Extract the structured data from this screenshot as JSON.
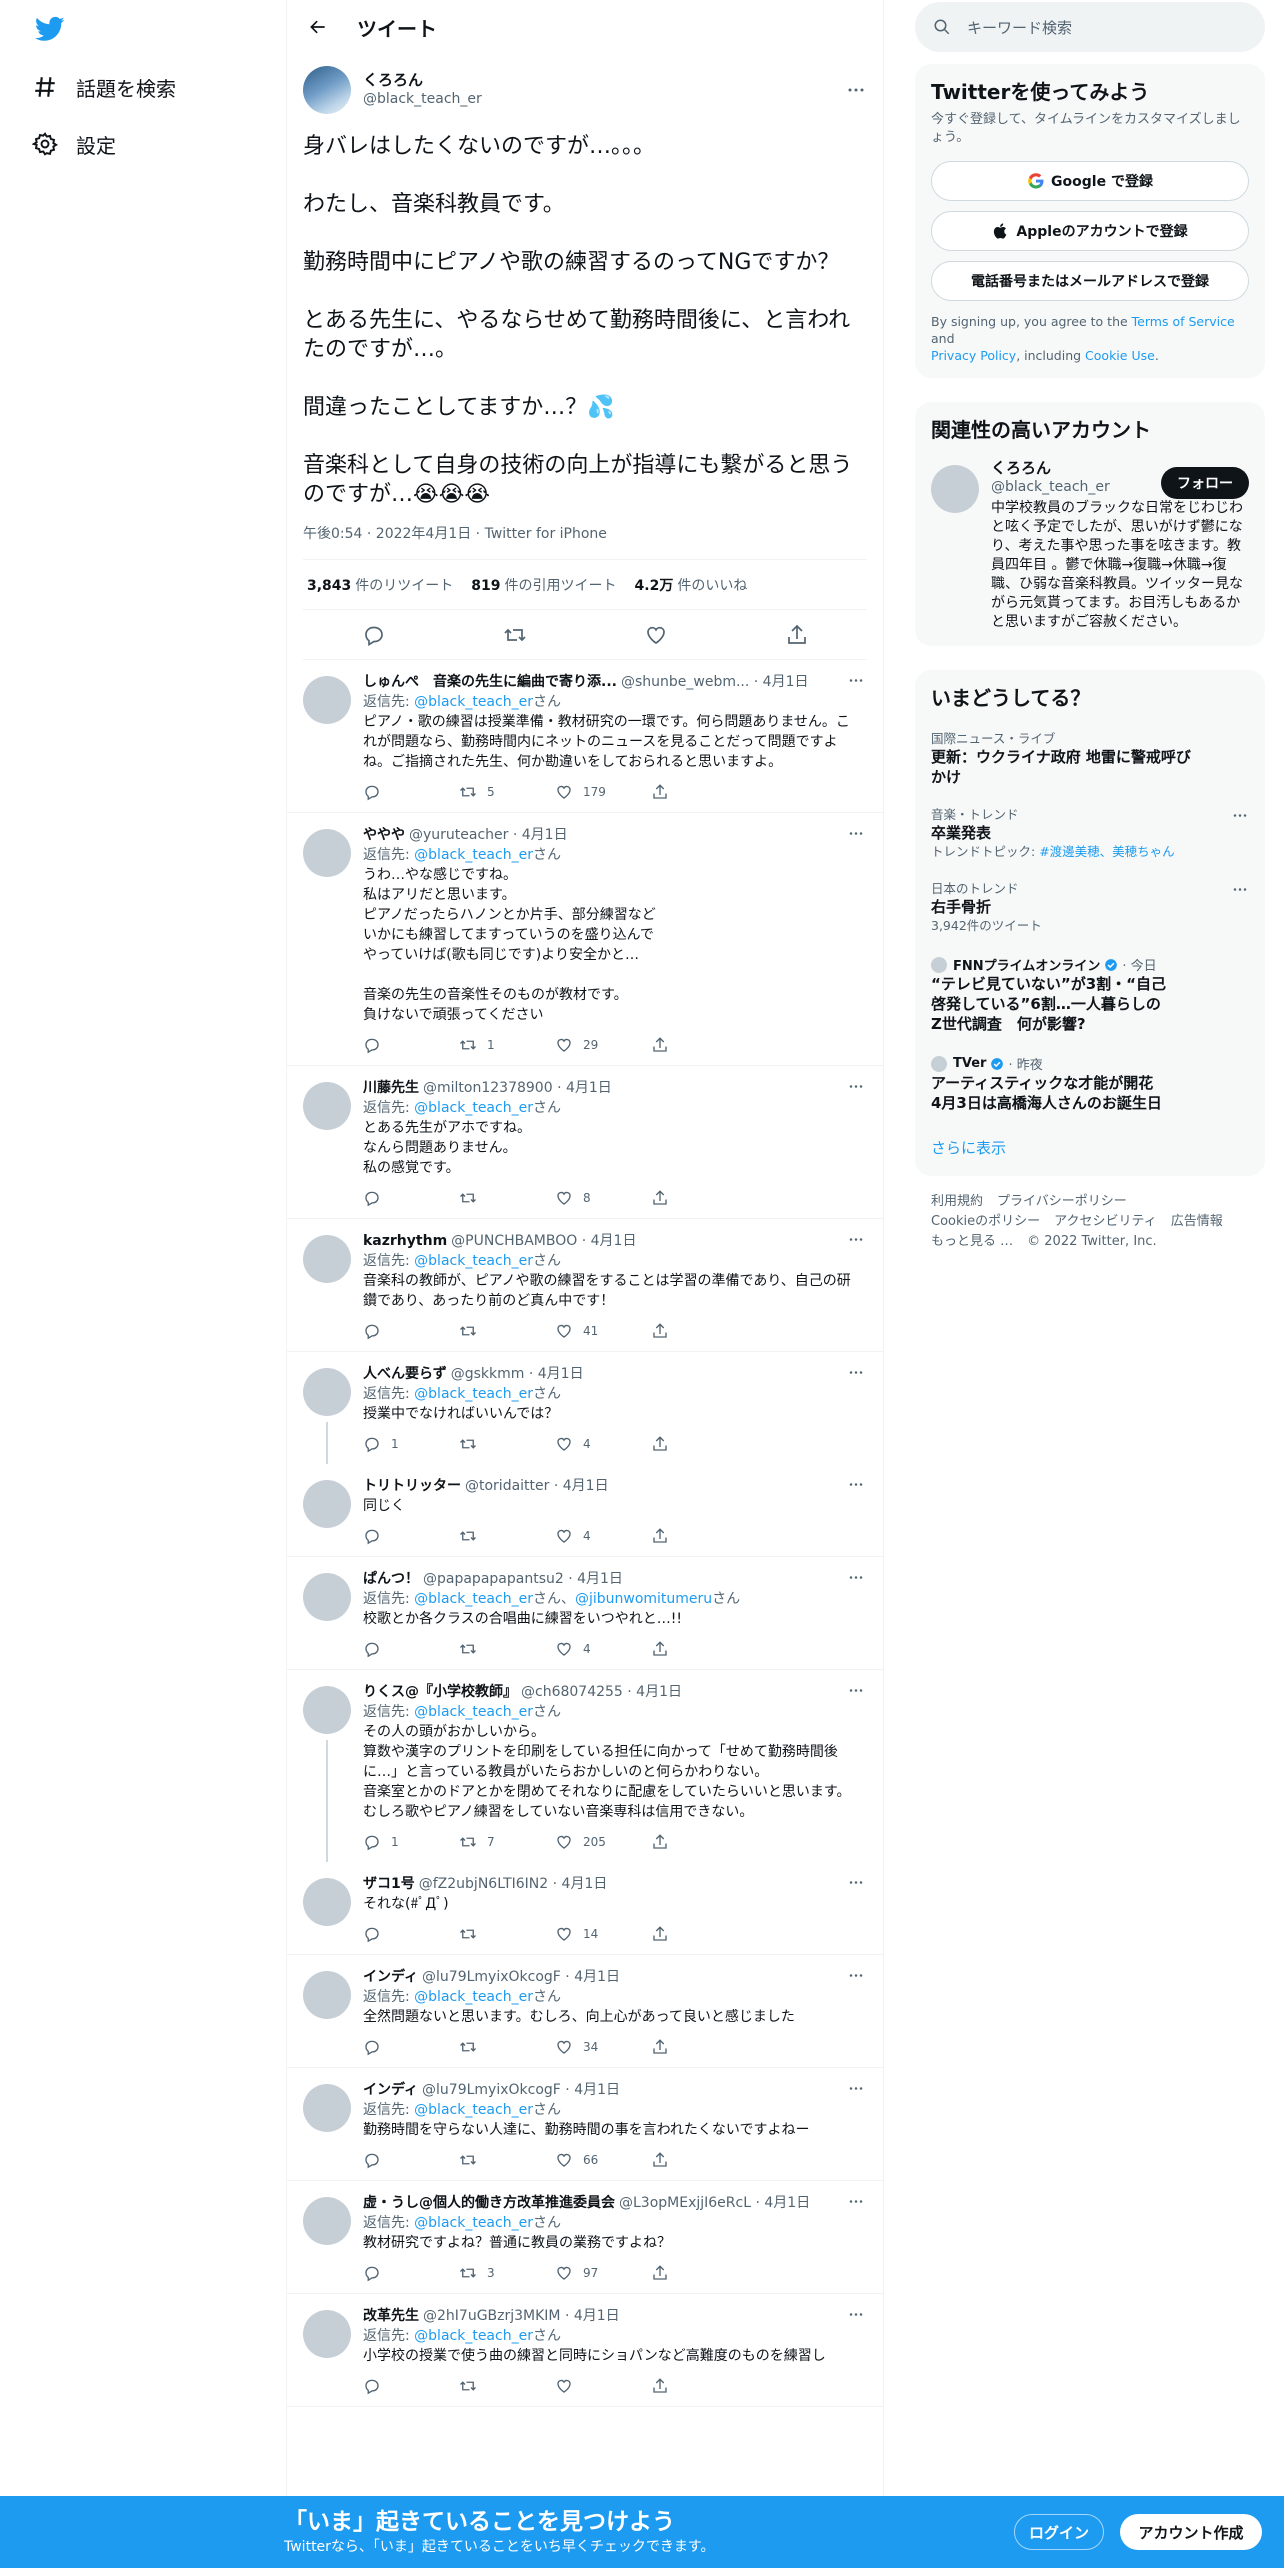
{
  "nav": {
    "explore_label": "話題を検索",
    "settings_label": "設定"
  },
  "header": {
    "title": "ツイート"
  },
  "tweet": {
    "name": "くろろん",
    "handle": "@black_teach_er",
    "paragraphs": [
      "身バレはしたくないのですが…。。。",
      "わたし、音楽科教員です。",
      "勤務時間中にピアノや歌の練習するのってNGですか？",
      "とある先生に、やるならせめて勤務時間後に、と言われたのですが…。",
      "間違ったことしてますか…？💦",
      "音楽科として自身の技術の向上が指導にも繋がると思うのですが…😭😭😭"
    ],
    "meta": "午後0:54 · 2022年4月1日 · Twitter for iPhone",
    "stats": [
      {
        "value": "3,843",
        "label": "件のリツイート"
      },
      {
        "value": "819",
        "label": "件の引用ツイート"
      },
      {
        "value": "4.2万",
        "label": "件のいいね"
      }
    ]
  },
  "replies": [
    {
      "name": "しゅんぺ　音楽の先生に編曲で寄り添...",
      "handle": "@shunbe_webm...",
      "date": "· 4月1日",
      "replyto": [
        "@black_teach_er"
      ],
      "text": "ピアノ・歌の練習は授業準備・教材研究の一環です。何ら問題ありません。これが問題なら、勤務時間内にネットのニュースを見ることだって問題ですよね。ご指摘された先生、何か勘違いをしておられると思いますよ。",
      "rt": "5",
      "like": "179"
    },
    {
      "name": "ややや",
      "handle": "@yuruteacher",
      "date": "· 4月1日",
      "replyto": [
        "@black_teach_er"
      ],
      "text": "うわ…やな感じですね。\n私はアリだと思います。\nピアノだったらハノンとか片手、部分練習など\nいかにも練習してますっていうのを盛り込んで\nやっていけば(歌も同じです)より安全かと…\n\n音楽の先生の音楽性そのものが教材です。\n負けないで頑張ってください",
      "rt": "1",
      "like": "29"
    },
    {
      "name": "川藤先生",
      "handle": "@milton12378900",
      "date": "· 4月1日",
      "replyto": [
        "@black_teach_er"
      ],
      "text": "とある先生がアホですね。\nなんら問題ありません。\n私の感覚です。",
      "rt": "",
      "like": "8"
    },
    {
      "name": "kazrhythm",
      "handle": "@PUNCHBAMBOO",
      "date": "· 4月1日",
      "replyto": [
        "@black_teach_er"
      ],
      "text": "音楽科の教師が、ピアノや歌の練習をすることは学習の準備であり、自己の研鑽であり、あったり前のど真ん中です！",
      "rt": "",
      "like": "41"
    },
    {
      "name": "人べん要らず",
      "handle": "@gskkmm",
      "date": "· 4月1日",
      "replyto": [
        "@black_teach_er"
      ],
      "text": "授業中でなければいいんでは？",
      "reply": "1",
      "rt": "",
      "like": "4",
      "thread": true
    },
    {
      "name": "トリトリッター",
      "handle": "@toridaitter",
      "date": "· 4月1日",
      "replyto": [],
      "text": "同じく",
      "rt": "",
      "like": "4"
    },
    {
      "name": "ぱんつ！",
      "handle": "@papapapapantsu2",
      "date": "· 4月1日",
      "replyto": [
        "@black_teach_er",
        "@jibunwomitumeru"
      ],
      "text": "校歌とか各クラスの合唱曲に練習をいつやれと…!!",
      "rt": "",
      "like": "4"
    },
    {
      "name": "りくス@『小学校教師』",
      "handle": "@ch68074255",
      "date": "· 4月1日",
      "replyto": [
        "@black_teach_er"
      ],
      "text": "その人の頭がおかしいから。\n算数や漢字のプリントを印刷をしている担任に向かって「せめて勤務時間後に…」と言っている教員がいたらおかしいのと何らかわりない。\n音楽室とかのドアとかを閉めてそれなりに配慮をしていたらいいと思います。むしろ歌やピアノ練習をしていない音楽専科は信用できない。",
      "reply": "1",
      "rt": "7",
      "like": "205",
      "thread": true
    },
    {
      "name": "ザコ1号",
      "handle": "@fZ2ubjN6LTI6IN2",
      "date": "· 4月1日",
      "replyto": [],
      "text": "それな(#ﾟДﾟ)",
      "rt": "",
      "like": "14"
    },
    {
      "name": "インディ",
      "handle": "@lu79LmyixOkcogF",
      "date": "· 4月1日",
      "replyto": [
        "@black_teach_er"
      ],
      "text": "全然問題ないと思います。むしろ、向上心があって良いと感じました",
      "rt": "",
      "like": "34"
    },
    {
      "name": "インディ",
      "handle": "@lu79LmyixOkcogF",
      "date": "· 4月1日",
      "replyto": [
        "@black_teach_er"
      ],
      "text": "勤務時間を守らない人達に、勤務時間の事を言われたくないですよねー",
      "rt": "",
      "like": "66"
    },
    {
      "name": "虚・うし@個人的働き方改革推進委員会",
      "handle": "@L3opMExjjI6eRcL",
      "date": "· 4月1日",
      "replyto": [
        "@black_teach_er"
      ],
      "text": "教材研究ですよね？普通に教員の業務ですよね？",
      "rt": "3",
      "like": "97"
    },
    {
      "name": "改革先生",
      "handle": "@2hI7uGBzrj3MKIM",
      "date": "· 4月1日",
      "replyto": [
        "@black_teach_er"
      ],
      "text": "小学校の授業で使う曲の練習と同時にショパンなど高難度のものを練習し",
      "rt": "",
      "like": ""
    }
  ],
  "replyto_prefix": "返信先: ",
  "replyto_suffix": "さん",
  "replyto_joiner": "、",
  "search": {
    "placeholder": "キーワード検索"
  },
  "signup_card": {
    "title": "Twitterを使ってみよう",
    "subtitle": "今すぐ登録して、タイムラインをカスタマイズしましょう。",
    "google_label": "Google で登録",
    "apple_label": "Appleのアカウントで登録",
    "phone_label": "電話番号またはメールアドレスで登録",
    "terms_pre": "By signing up, you agree to the ",
    "terms_link": "Terms of Service",
    "terms_and": " and ",
    "privacy_link": "Privacy Policy",
    "terms_including": ", including ",
    "cookie_link": "Cookie Use",
    "terms_end": "."
  },
  "related": {
    "title": "関連性の高いアカウント",
    "name": "くろろん",
    "handle": "@black_teach_er",
    "follow_label": "フォロー",
    "bio": "中学校教員のブラックな日常をじわじわと呟く予定でしたが、思いがけず鬱になり、考えた事や思った事を呟きます。教員四年目 。鬱で休職→復職→休職→復職、ひ弱な音楽科教員。ツイッター見ながら元気貰ってます。お目汚しもあるかと思いますがご容赦ください。"
  },
  "trends": {
    "title": "いまどうしてる？",
    "items": [
      {
        "cat": "国際ニュース・ライブ",
        "name": "更新：ウクライナ政府 地雷に警戒呼びかけ"
      },
      {
        "cat": "音楽・トレンド",
        "name": "卒業発表",
        "sub_pre": "トレンドトピック: ",
        "sub_link": "#渡邊美穂、美穂ちゃん"
      },
      {
        "cat": "日本のトレンド",
        "name": "右手骨折",
        "sub": "3,942件のツイート"
      }
    ],
    "news": [
      {
        "source": "FNNプライムオンライン",
        "time": "· 今日",
        "title": "“テレビ見ていない”が3割・“自己啓発している”6割…一人暮らしのZ世代調査　何が影響?"
      },
      {
        "source": "TVer",
        "time": "· 昨夜",
        "title": "アーティスティックな才能が開花　4月3日は高橋海人さんのお誕生日"
      }
    ],
    "show_more": "さらに表示"
  },
  "footer": {
    "links": [
      "利用規約",
      "プライバシーポリシー",
      "Cookieのポリシー",
      "アクセシビリティ",
      "広告情報",
      "もっと見る …"
    ],
    "copyright": "© 2022 Twitter, Inc."
  },
  "banner": {
    "title": "「いま」起きていることを見つけよう",
    "subtitle": "Twitterなら、「いま」起きていることをいち早くチェックできます。",
    "login_label": "ログイン",
    "signup_label": "アカウント作成"
  },
  "colors": {
    "accent": "#1d9bf0",
    "text": "#0f1419",
    "muted": "#536471"
  }
}
